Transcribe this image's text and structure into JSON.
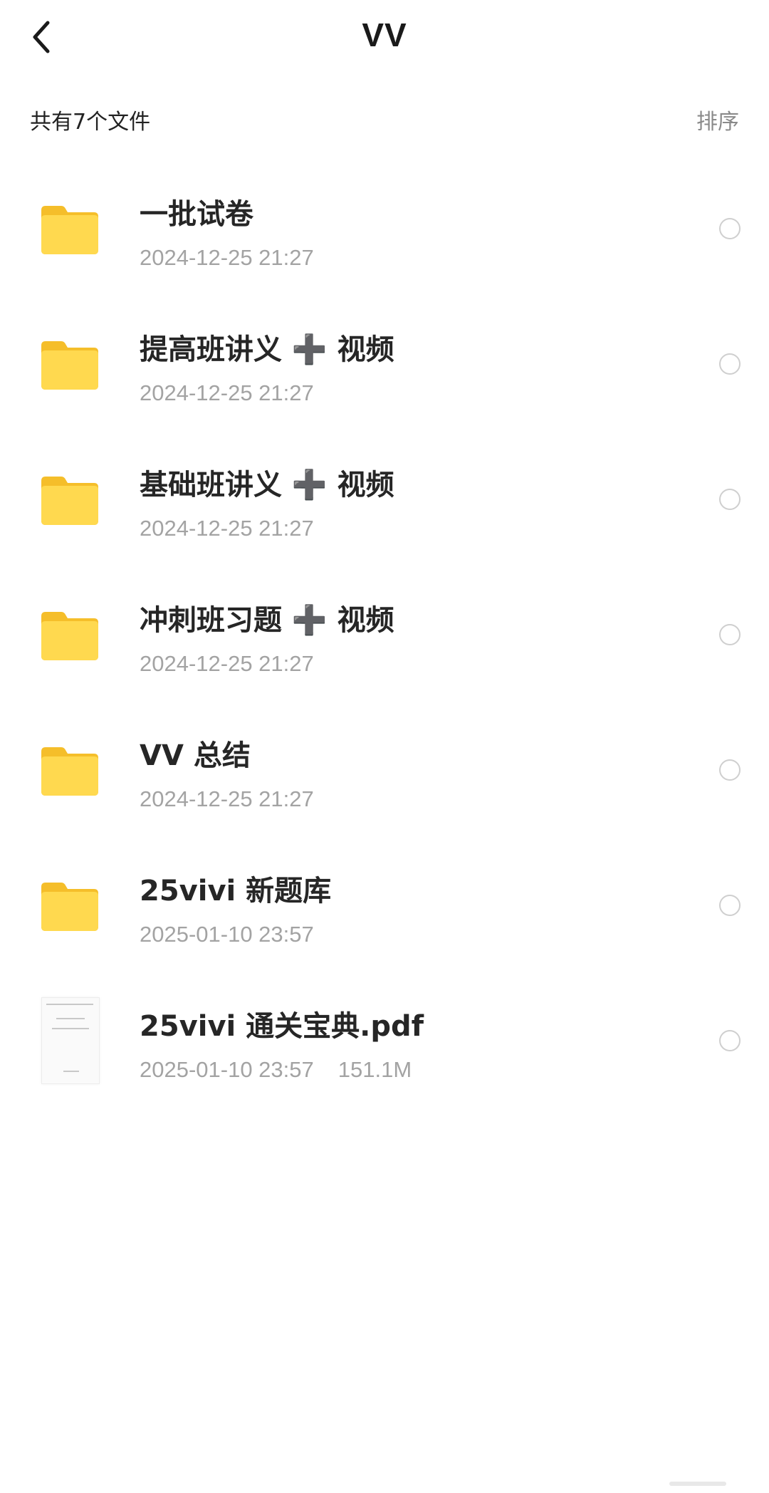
{
  "header": {
    "title": "VV",
    "back_icon": "chevron-left-icon"
  },
  "toolbar": {
    "file_count_label": "共有7个文件",
    "sort_label": "排序"
  },
  "files": [
    {
      "name": "一批试卷",
      "date": "2024-12-25 21:27",
      "type": "folder"
    },
    {
      "name": "提高班讲义 ➕ 视频",
      "date": "2024-12-25 21:27",
      "type": "folder"
    },
    {
      "name": "基础班讲义 ➕ 视频",
      "date": "2024-12-25 21:27",
      "type": "folder"
    },
    {
      "name": "冲刺班习题 ➕ 视频",
      "date": "2024-12-25 21:27",
      "type": "folder"
    },
    {
      "name": "VV 总结",
      "date": "2024-12-25 21:27",
      "type": "folder"
    },
    {
      "name": "25vivi 新题库",
      "date": "2025-01-10 23:57",
      "type": "folder"
    },
    {
      "name": "25vivi 通关宝典.pdf",
      "date": "2025-01-10 23:57",
      "size": "151.1M",
      "type": "pdf"
    }
  ],
  "colors": {
    "folder_yellow": "#FBCD3C",
    "folder_yellow_light": "#FFE07A",
    "text_primary": "#262626",
    "text_secondary": "#A3A3A3"
  }
}
